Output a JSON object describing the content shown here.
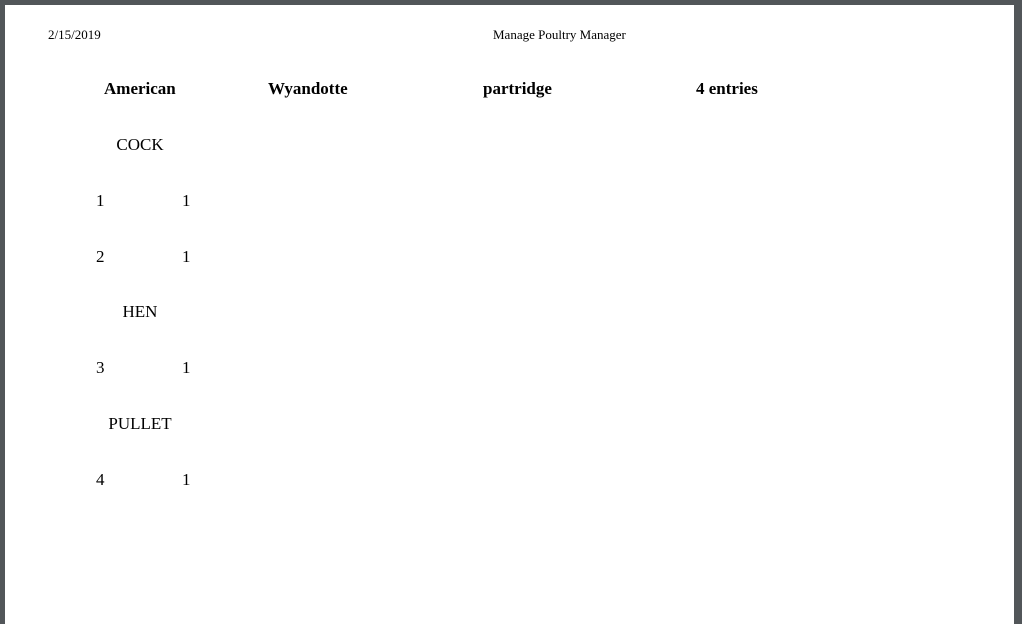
{
  "print_header": {
    "date": "2/15/2019",
    "title": "Manage Poultry Manager"
  },
  "report_header": {
    "class": "American",
    "breed": "Wyandotte",
    "variety": "partridge",
    "entries": "4 entries"
  },
  "sections": [
    {
      "label": "COCK",
      "rows": [
        {
          "entry": "1",
          "qty": "1"
        },
        {
          "entry": "2",
          "qty": "1"
        }
      ]
    },
    {
      "label": "HEN",
      "rows": [
        {
          "entry": "3",
          "qty": "1"
        }
      ]
    },
    {
      "label": "PULLET",
      "rows": [
        {
          "entry": "4",
          "qty": "1"
        }
      ]
    }
  ]
}
